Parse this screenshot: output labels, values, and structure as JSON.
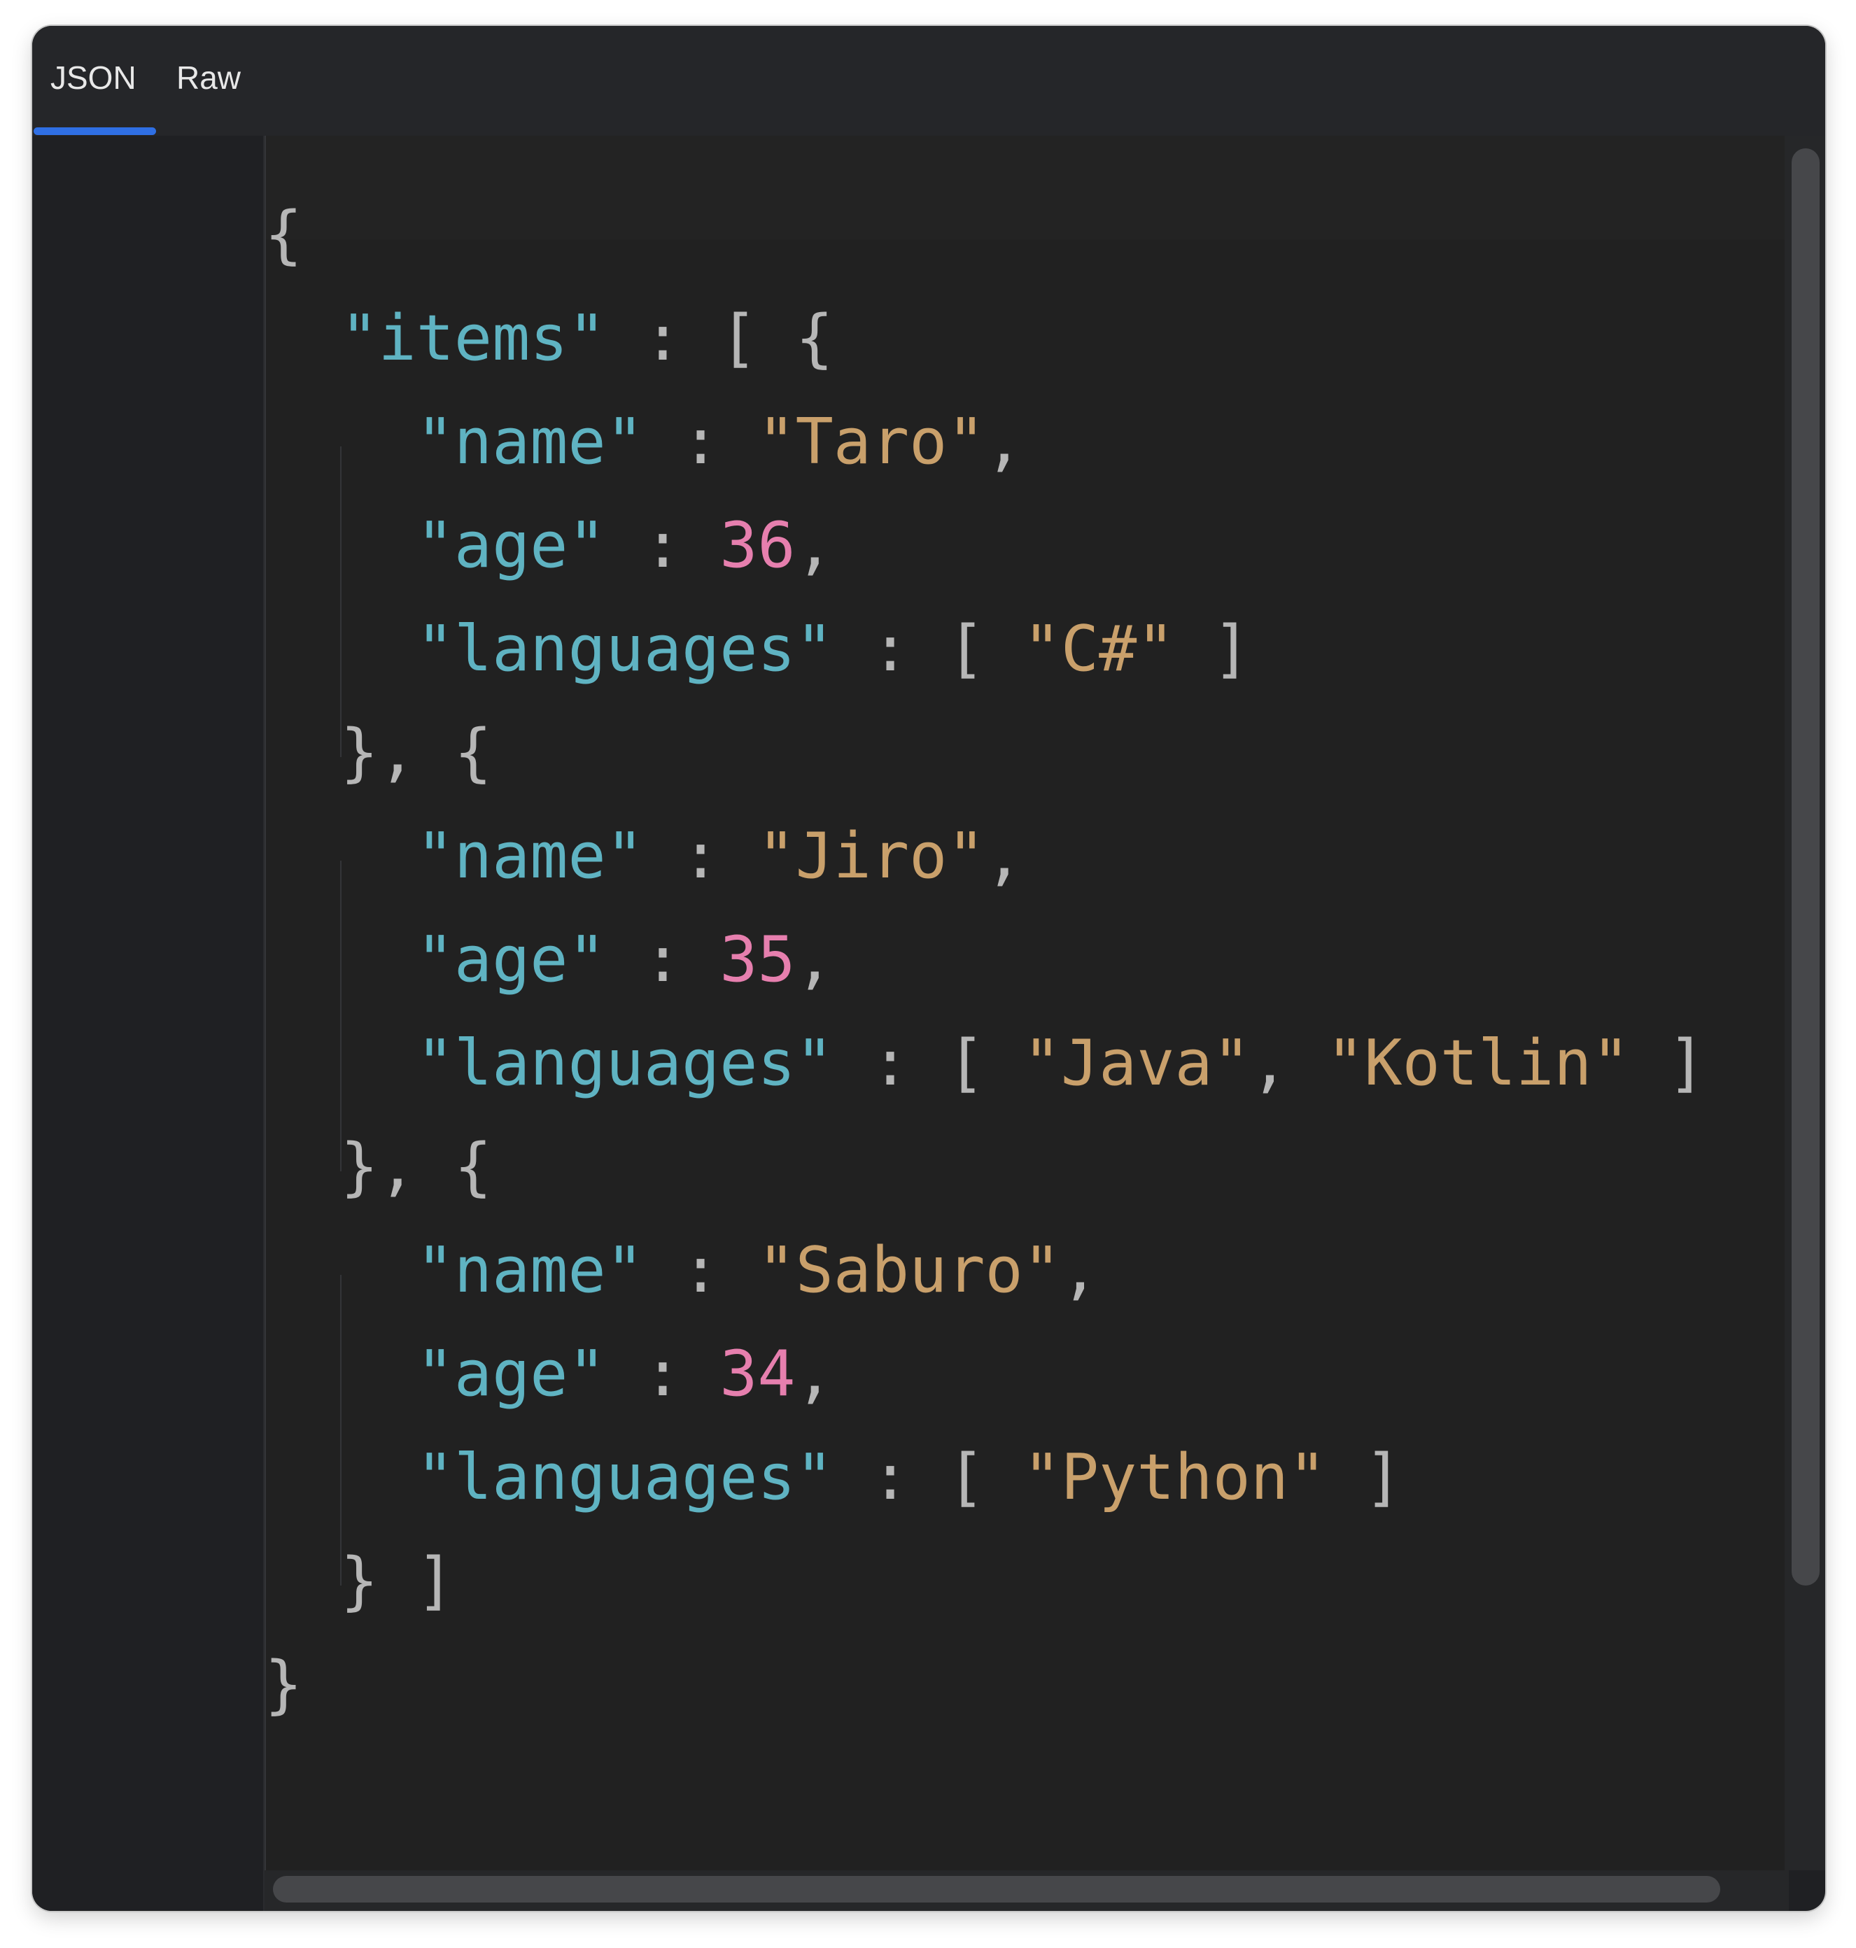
{
  "tabs": [
    {
      "label": "JSON",
      "active": true
    },
    {
      "label": "Raw",
      "active": false
    }
  ],
  "colors": {
    "key": "#5fb3c2",
    "string": "#c9a06b",
    "number": "#e67fae",
    "punctuation": "#b6b6b6",
    "active_tab_indicator": "#2f6fe4"
  },
  "lines": [
    [
      {
        "t": "{",
        "c": "p"
      }
    ],
    [
      {
        "t": "  "
      },
      {
        "t": "\"items\"",
        "c": "k"
      },
      {
        "t": " : [ {",
        "c": "p"
      }
    ],
    [
      {
        "t": "    "
      },
      {
        "t": "\"name\"",
        "c": "k"
      },
      {
        "t": " : ",
        "c": "p"
      },
      {
        "t": "\"Taro\"",
        "c": "s"
      },
      {
        "t": ",",
        "c": "p"
      }
    ],
    [
      {
        "t": "    "
      },
      {
        "t": "\"age\"",
        "c": "k"
      },
      {
        "t": " : ",
        "c": "p"
      },
      {
        "t": "36",
        "c": "n"
      },
      {
        "t": ",",
        "c": "p"
      }
    ],
    [
      {
        "t": "    "
      },
      {
        "t": "\"languages\"",
        "c": "k"
      },
      {
        "t": " : [ ",
        "c": "p"
      },
      {
        "t": "\"C#\"",
        "c": "s"
      },
      {
        "t": " ]",
        "c": "p"
      }
    ],
    [
      {
        "t": "  "
      },
      {
        "t": "}, {",
        "c": "p"
      }
    ],
    [
      {
        "t": "    "
      },
      {
        "t": "\"name\"",
        "c": "k"
      },
      {
        "t": " : ",
        "c": "p"
      },
      {
        "t": "\"Jiro\"",
        "c": "s"
      },
      {
        "t": ",",
        "c": "p"
      }
    ],
    [
      {
        "t": "    "
      },
      {
        "t": "\"age\"",
        "c": "k"
      },
      {
        "t": " : ",
        "c": "p"
      },
      {
        "t": "35",
        "c": "n"
      },
      {
        "t": ",",
        "c": "p"
      }
    ],
    [
      {
        "t": "    "
      },
      {
        "t": "\"languages\"",
        "c": "k"
      },
      {
        "t": " : [ ",
        "c": "p"
      },
      {
        "t": "\"Java\"",
        "c": "s"
      },
      {
        "t": ", ",
        "c": "p"
      },
      {
        "t": "\"Kotlin\"",
        "c": "s"
      },
      {
        "t": " ]",
        "c": "p"
      }
    ],
    [
      {
        "t": "  "
      },
      {
        "t": "}, {",
        "c": "p"
      }
    ],
    [
      {
        "t": "    "
      },
      {
        "t": "\"name\"",
        "c": "k"
      },
      {
        "t": " : ",
        "c": "p"
      },
      {
        "t": "\"Saburo\"",
        "c": "s"
      },
      {
        "t": ",",
        "c": "p"
      }
    ],
    [
      {
        "t": "    "
      },
      {
        "t": "\"age\"",
        "c": "k"
      },
      {
        "t": " : ",
        "c": "p"
      },
      {
        "t": "34",
        "c": "n"
      },
      {
        "t": ",",
        "c": "p"
      }
    ],
    [
      {
        "t": "    "
      },
      {
        "t": "\"languages\"",
        "c": "k"
      },
      {
        "t": " : [ ",
        "c": "p"
      },
      {
        "t": "\"Python\"",
        "c": "s"
      },
      {
        "t": " ]",
        "c": "p"
      }
    ],
    [
      {
        "t": "  "
      },
      {
        "t": "} ]",
        "c": "p"
      }
    ],
    [
      {
        "t": "}",
        "c": "p"
      }
    ]
  ]
}
